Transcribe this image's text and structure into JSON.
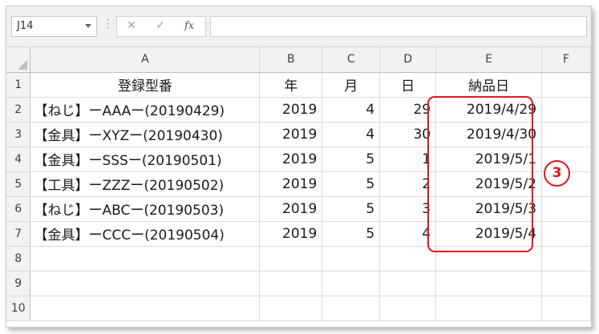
{
  "formula_bar": {
    "name_box": "J14",
    "grip": "⋮",
    "cancel_icon": "✕",
    "enter_icon": "✓",
    "fx_label": "fx",
    "formula": ""
  },
  "columns": [
    "A",
    "B",
    "C",
    "D",
    "E",
    "F"
  ],
  "rows": [
    {
      "num": "1",
      "A": "登録型番",
      "B": "年",
      "C": "月",
      "D": "日",
      "E": "納品日",
      "F": ""
    },
    {
      "num": "2",
      "A": "【ねじ】ーAAAー(20190429)",
      "B": "2019",
      "C": "4",
      "D": "29",
      "E": "2019/4/29",
      "F": ""
    },
    {
      "num": "3",
      "A": "【金具】ーXYZー(20190430)",
      "B": "2019",
      "C": "4",
      "D": "30",
      "E": "2019/4/30",
      "F": ""
    },
    {
      "num": "4",
      "A": "【金具】ーSSSー(20190501)",
      "B": "2019",
      "C": "5",
      "D": "1",
      "E": "2019/5/1",
      "F": ""
    },
    {
      "num": "5",
      "A": "【工具】ーZZZー(20190502)",
      "B": "2019",
      "C": "5",
      "D": "2",
      "E": "2019/5/2",
      "F": ""
    },
    {
      "num": "6",
      "A": "【ねじ】ーABCー(20190503)",
      "B": "2019",
      "C": "5",
      "D": "3",
      "E": "2019/5/3",
      "F": ""
    },
    {
      "num": "7",
      "A": "【金具】ーCCCー(20190504)",
      "B": "2019",
      "C": "5",
      "D": "4",
      "E": "2019/5/4",
      "F": ""
    },
    {
      "num": "8",
      "A": "",
      "B": "",
      "C": "",
      "D": "",
      "E": "",
      "F": ""
    },
    {
      "num": "9",
      "A": "",
      "B": "",
      "C": "",
      "D": "",
      "E": "",
      "F": ""
    },
    {
      "num": "10",
      "A": "",
      "B": "",
      "C": "",
      "D": "",
      "E": "",
      "F": ""
    }
  ],
  "annotation": {
    "badge_label": "3",
    "color": "#e0141e"
  }
}
